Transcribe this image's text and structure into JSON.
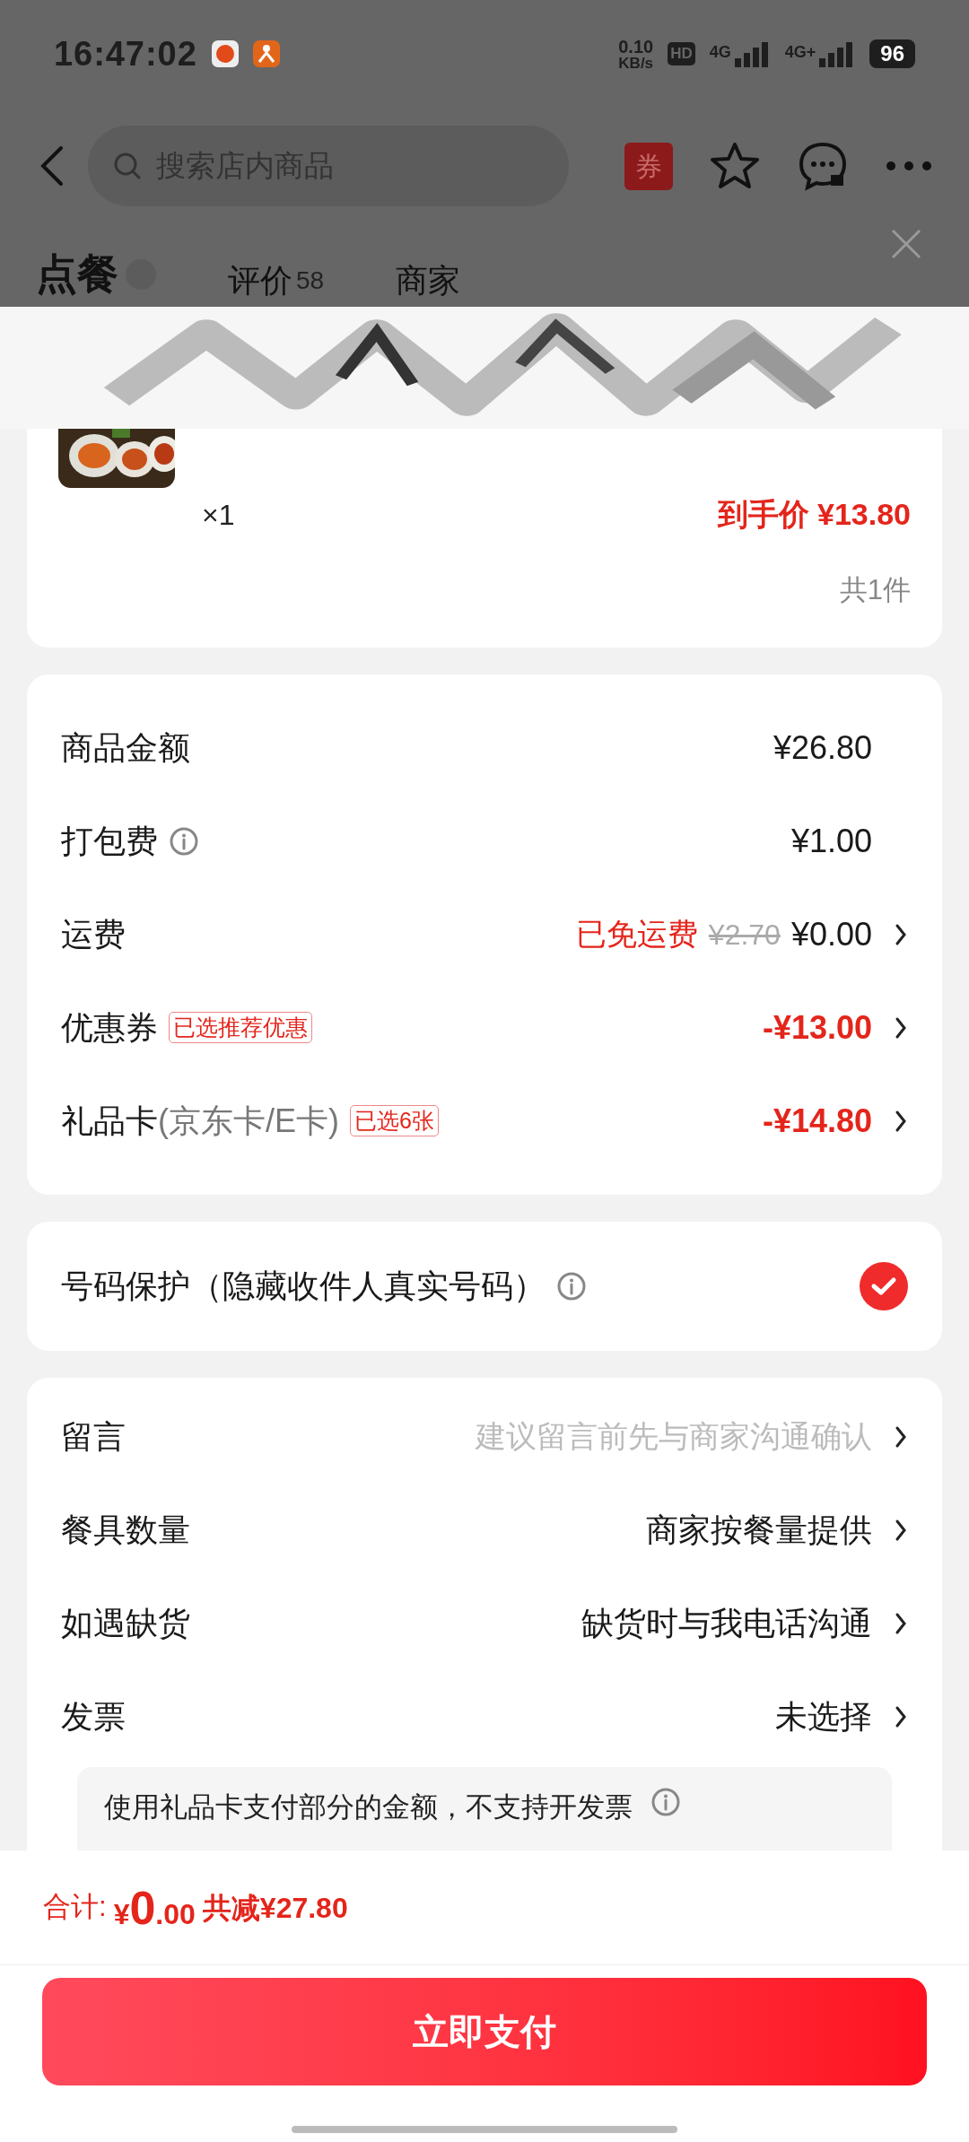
{
  "status_bar": {
    "time": "16:47:02",
    "net_speed": "0.10",
    "net_unit": "KB/s",
    "hd": "HD",
    "signal_1": "4G",
    "signal_2": "4G+",
    "battery": "96"
  },
  "header": {
    "search": {
      "placeholder": "搜索店内商品"
    },
    "coupon": "券"
  },
  "tabs": [
    {
      "label": "点餐",
      "selected": true
    },
    {
      "label": "评价",
      "count": "58",
      "selected": false
    },
    {
      "label": "商家",
      "selected": false
    }
  ],
  "product": {
    "quantity": "×1",
    "final_price": "到手价 ¥13.80",
    "total_items": "共1件"
  },
  "price_rows": [
    {
      "label": "商品金额",
      "value": "¥26.80",
      "negative": false,
      "chevron": false
    },
    {
      "label": "打包费",
      "info": true,
      "value": "¥1.00",
      "negative": false,
      "chevron": false
    },
    {
      "label": "运费",
      "note": "已免运费",
      "original": "¥2.70",
      "value": "¥0.00",
      "negative": false,
      "chevron": true
    },
    {
      "label": "优惠券",
      "tag": "已选推荐优惠",
      "value": "-¥13.00",
      "negative": true,
      "chevron": true
    },
    {
      "label": "礼品卡",
      "sublabel": "(京东卡/E卡)",
      "tag": "已选6张",
      "value": "-¥14.80",
      "negative": true,
      "chevron": true
    }
  ],
  "number_protection": {
    "label": "号码保护（隐藏收件人真实号码）",
    "checked": true
  },
  "options": [
    {
      "label": "留言",
      "placeholder": "建议留言前先与商家沟通确认"
    },
    {
      "label": "餐具数量",
      "value": "商家按餐量提供"
    },
    {
      "label": "如遇缺货",
      "value": "缺货时与我电话沟通"
    },
    {
      "label": "发票",
      "value": "未选择"
    }
  ],
  "invoice_note": "使用礼品卡支付部分的金额，不支持开发票",
  "footer": {
    "total_label": "合计:",
    "currency": "¥",
    "integer": "0",
    "decimals": ".00",
    "discount": "共减¥27.80",
    "pay_button": "立即支付"
  }
}
